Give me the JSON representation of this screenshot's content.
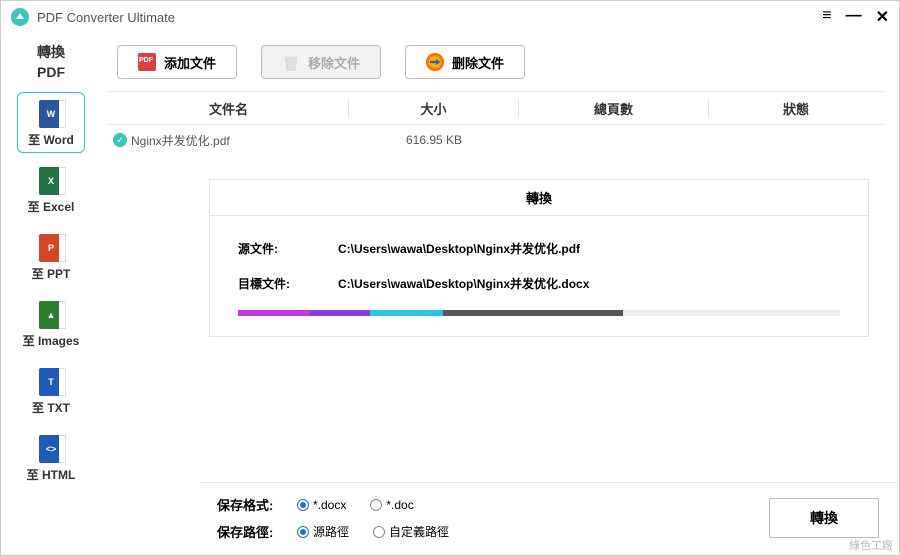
{
  "app": {
    "title": "PDF Converter Ultimate"
  },
  "sidebar": {
    "header_line1": "轉換",
    "header_line2": "PDF",
    "items": [
      {
        "label": "至 Word"
      },
      {
        "label": "至 Excel"
      },
      {
        "label": "至 PPT"
      },
      {
        "label": "至 Images"
      },
      {
        "label": "至 TXT"
      },
      {
        "label": "至 HTML"
      }
    ]
  },
  "toolbar": {
    "add": "添加文件",
    "remove": "移除文件",
    "delete": "删除文件"
  },
  "table": {
    "headers": {
      "name": "文件名",
      "size": "大小",
      "pages": "總頁數",
      "status": "狀態"
    },
    "rows": [
      {
        "name": "Nginx并发优化.pdf",
        "size": "616.95 KB"
      }
    ]
  },
  "panel": {
    "title": "轉換",
    "source_label": "源文件:",
    "source_value": "C:\\Users\\wawa\\Desktop\\Nginx并发优化.pdf",
    "target_label": "目標文件:",
    "target_value": "C:\\Users\\wawa\\Desktop\\Nginx并发优化.docx"
  },
  "footer": {
    "format_label": "保存格式:",
    "format_opts": [
      "*.docx",
      "*.doc"
    ],
    "path_label": "保存路徑:",
    "path_opts": [
      "源路徑",
      "自定義路徑"
    ],
    "convert": "轉換"
  },
  "watermark": "綠色工廠"
}
